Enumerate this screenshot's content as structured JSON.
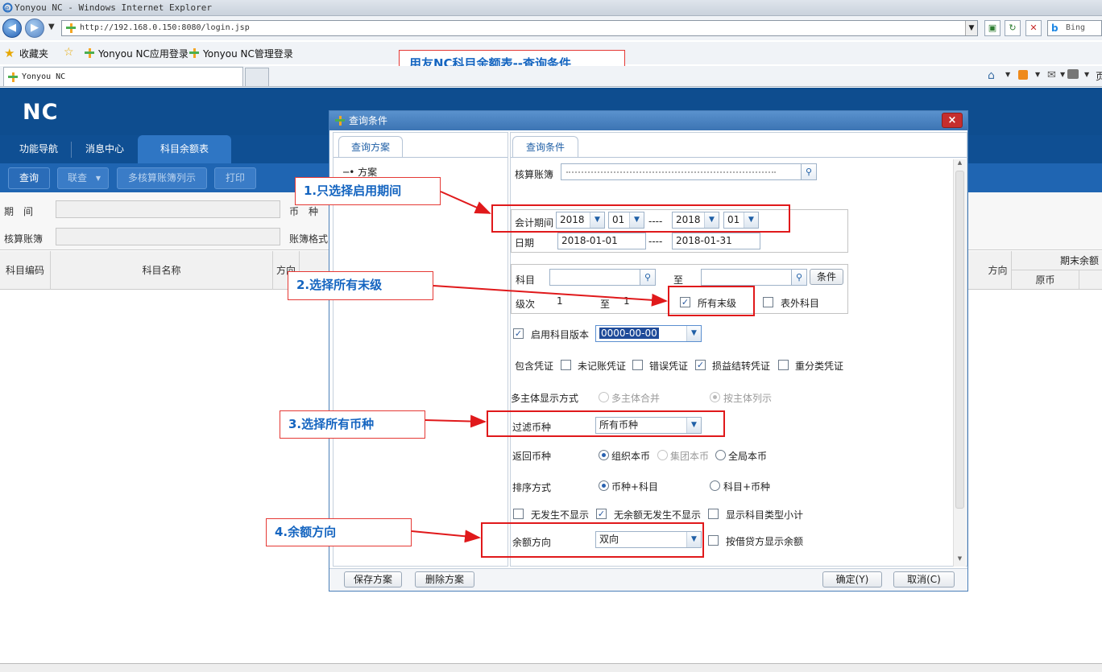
{
  "browser": {
    "window_title": "Yonyou NC - Windows Internet Explorer",
    "url": "http://192.168.0.150:8080/login.jsp",
    "search_placeholder": "Bing",
    "favorites_label": "收藏夹",
    "favorite_links": [
      "Yonyou NC应用登录",
      "Yonyou NC管理登录"
    ],
    "tab_title": "Yonyou NC",
    "page_menu_glyph": "页"
  },
  "annotation_title": "用友NC科目余额表--查询条件",
  "app": {
    "logo": "NC",
    "tabs": [
      "功能导航",
      "消息中心",
      "科目余额表"
    ],
    "toolbar": [
      "查询",
      "联查",
      "多核算账簿列示",
      "打印"
    ],
    "filter": {
      "period_label": "期　间",
      "currency_label": "币　种",
      "book_label": "核算账簿",
      "format_label": "账簿格式"
    },
    "grid": {
      "col_code": "科目编码",
      "col_name": "科目名称",
      "col_dir": "方向",
      "col_dir_right": "方向",
      "col_end_balance": "期末余额",
      "col_original": "原币"
    }
  },
  "dialog": {
    "title": "查询条件",
    "close": "×",
    "left_tab": "查询方案",
    "tree_item": "方案",
    "right_tab": "查询条件",
    "book_label": "核算账簿",
    "period_label": "会计期间",
    "year_from": "2018",
    "month_from": "01",
    "dash": "----",
    "year_to": "2018",
    "month_to": "01",
    "date_label": "日期",
    "date_from": "2018-01-01",
    "date_to": "2018-01-31",
    "subject_label": "科目",
    "to_label": "至",
    "condition_btn": "条件",
    "level_label": "级次",
    "level_from": "1",
    "level_to_label": "至",
    "level_to": "1",
    "all_leaf": "所有末级",
    "off_sheet": "表外科目",
    "use_version": "启用科目版本",
    "version": "0000-00-00",
    "include_label": "包含凭证",
    "voucher_opts": [
      "未记账凭证",
      "错误凭证",
      "损益结转凭证",
      "重分类凭证"
    ],
    "multi_label": "多主体显示方式",
    "multi_merge": "多主体合并",
    "multi_list": "按主体列示",
    "filter_currency_label": "过滤币种",
    "filter_currency": "所有币种",
    "return_currency_label": "返回币种",
    "return_opts": [
      "组织本币",
      "集团本币",
      "全局本币"
    ],
    "sort_label": "排序方式",
    "sort_opts": [
      "币种+科目",
      "科目+币种"
    ],
    "display_opts": [
      "无发生不显示",
      "无余额无发生不显示",
      "显示科目类型小计"
    ],
    "balance_dir_label": "余额方向",
    "balance_dir": "双向",
    "by_credit": "按借贷方显示余额",
    "save_btn": "保存方案",
    "delete_btn": "删除方案",
    "ok_btn": "确定(Y)",
    "cancel_btn": "取消(C)"
  },
  "annotations": [
    "1.只选择启用期间",
    "2.选择所有末级",
    "3.选择所有币种",
    "4.余额方向"
  ],
  "colors": {
    "nc_blue": "#0e4d8f",
    "annotation_red": "#e0191b",
    "annotation_text": "#1565c0"
  }
}
